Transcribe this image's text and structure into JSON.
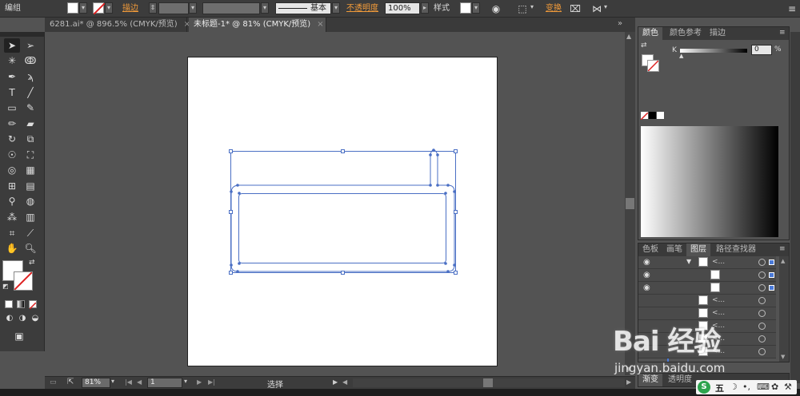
{
  "control_bar": {
    "group_label": "编组",
    "stroke_label": "描边",
    "stroke_style_label": "基本",
    "opacity_label": "不透明度",
    "opacity_value": "100%",
    "style_label": "样式",
    "transform_label": "变换"
  },
  "tabs": [
    {
      "label": "6281.ai* @ 896.5% (CMYK/预览)",
      "close": "×"
    },
    {
      "label": "未标题-1* @ 81% (CMYK/预览)",
      "close": "×"
    }
  ],
  "status_bar": {
    "zoom": "81%",
    "page": "1",
    "mode": "选择"
  },
  "color_panel": {
    "tabs": [
      "颜色",
      "颜色参考",
      "描边"
    ],
    "channel_label": "K",
    "channel_value": "0",
    "percent": "%"
  },
  "layers_panel": {
    "tabs": [
      "色板",
      "画笔",
      "图层",
      "路径查找器"
    ],
    "rows": [
      {
        "name": "<...",
        "indent": 0
      },
      {
        "name": "",
        "indent": 1
      },
      {
        "name": "",
        "indent": 1
      },
      {
        "name": "<...",
        "indent": 0
      },
      {
        "name": "<...",
        "indent": 0
      },
      {
        "name": "<...",
        "indent": 0
      },
      {
        "name": "<...",
        "indent": 0
      },
      {
        "name": "<...",
        "indent": 0
      }
    ]
  },
  "bottom_panel": {
    "tabs": [
      "渐变",
      "透明度"
    ]
  },
  "watermark": {
    "brand": "Bai 经验",
    "url": "jingyan.baidu.com"
  },
  "taskbar": {
    "ime": "五"
  },
  "colors": {
    "path_blue": "#4a6fc4",
    "ui_dark": "#3c3c3c",
    "accent_orange": "#f09a3a"
  }
}
